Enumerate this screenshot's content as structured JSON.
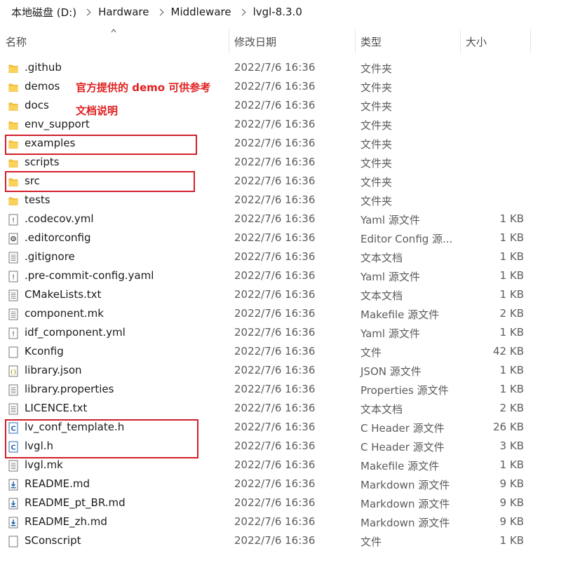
{
  "breadcrumb": [
    "本地磁盘 (D:)",
    "Hardware",
    "Middleware",
    "lvgl-8.3.0"
  ],
  "columns": {
    "name": "名称",
    "date": "修改日期",
    "type": "类型",
    "size": "大小"
  },
  "files": [
    {
      "name": ".github",
      "date": "2022/7/6 16:36",
      "type": "文件夹",
      "size": "",
      "icon": "folder-icon"
    },
    {
      "name": "demos",
      "date": "2022/7/6 16:36",
      "type": "文件夹",
      "size": "",
      "icon": "folder-icon"
    },
    {
      "name": "docs",
      "date": "2022/7/6 16:36",
      "type": "文件夹",
      "size": "",
      "icon": "folder-icon"
    },
    {
      "name": "env_support",
      "date": "2022/7/6 16:36",
      "type": "文件夹",
      "size": "",
      "icon": "folder-icon"
    },
    {
      "name": "examples",
      "date": "2022/7/6 16:36",
      "type": "文件夹",
      "size": "",
      "icon": "folder-icon"
    },
    {
      "name": "scripts",
      "date": "2022/7/6 16:36",
      "type": "文件夹",
      "size": "",
      "icon": "folder-icon"
    },
    {
      "name": "src",
      "date": "2022/7/6 16:36",
      "type": "文件夹",
      "size": "",
      "icon": "folder-icon"
    },
    {
      "name": "tests",
      "date": "2022/7/6 16:36",
      "type": "文件夹",
      "size": "",
      "icon": "folder-icon"
    },
    {
      "name": ".codecov.yml",
      "date": "2022/7/6 16:36",
      "type": "Yaml 源文件",
      "size": "1 KB",
      "icon": "yaml-file-icon"
    },
    {
      "name": ".editorconfig",
      "date": "2022/7/6 16:36",
      "type": "Editor Config 源...",
      "size": "1 KB",
      "icon": "config-file-icon"
    },
    {
      "name": ".gitignore",
      "date": "2022/7/6 16:36",
      "type": "文本文档",
      "size": "1 KB",
      "icon": "text-file-icon"
    },
    {
      "name": ".pre-commit-config.yaml",
      "date": "2022/7/6 16:36",
      "type": "Yaml 源文件",
      "size": "1 KB",
      "icon": "yaml-file-icon"
    },
    {
      "name": "CMakeLists.txt",
      "date": "2022/7/6 16:36",
      "type": "文本文档",
      "size": "1 KB",
      "icon": "text-file-icon"
    },
    {
      "name": "component.mk",
      "date": "2022/7/6 16:36",
      "type": "Makefile 源文件",
      "size": "2 KB",
      "icon": "text-file-icon"
    },
    {
      "name": "idf_component.yml",
      "date": "2022/7/6 16:36",
      "type": "Yaml 源文件",
      "size": "1 KB",
      "icon": "yaml-file-icon"
    },
    {
      "name": "Kconfig",
      "date": "2022/7/6 16:36",
      "type": "文件",
      "size": "42 KB",
      "icon": "blank-file-icon"
    },
    {
      "name": "library.json",
      "date": "2022/7/6 16:36",
      "type": "JSON 源文件",
      "size": "1 KB",
      "icon": "json-file-icon"
    },
    {
      "name": "library.properties",
      "date": "2022/7/6 16:36",
      "type": "Properties 源文件",
      "size": "1 KB",
      "icon": "text-file-icon"
    },
    {
      "name": "LICENCE.txt",
      "date": "2022/7/6 16:36",
      "type": "文本文档",
      "size": "2 KB",
      "icon": "text-file-icon"
    },
    {
      "name": "lv_conf_template.h",
      "date": "2022/7/6 16:36",
      "type": "C Header 源文件",
      "size": "26 KB",
      "icon": "c-header-file-icon"
    },
    {
      "name": "lvgl.h",
      "date": "2022/7/6 16:36",
      "type": "C Header 源文件",
      "size": "3 KB",
      "icon": "c-header-file-icon"
    },
    {
      "name": "lvgl.mk",
      "date": "2022/7/6 16:36",
      "type": "Makefile 源文件",
      "size": "1 KB",
      "icon": "text-file-icon"
    },
    {
      "name": "README.md",
      "date": "2022/7/6 16:36",
      "type": "Markdown 源文件",
      "size": "9 KB",
      "icon": "markdown-file-icon"
    },
    {
      "name": "README_pt_BR.md",
      "date": "2022/7/6 16:36",
      "type": "Markdown 源文件",
      "size": "9 KB",
      "icon": "markdown-file-icon"
    },
    {
      "name": "README_zh.md",
      "date": "2022/7/6 16:36",
      "type": "Markdown 源文件",
      "size": "9 KB",
      "icon": "markdown-file-icon"
    },
    {
      "name": "SConscript",
      "date": "2022/7/6 16:36",
      "type": "文件",
      "size": "1 KB",
      "icon": "blank-file-icon"
    }
  ],
  "annotations": {
    "demos_note": "官方提供的 demo 可供参考",
    "docs_note": "文档说明"
  },
  "colors": {
    "annotation": "#e02020",
    "folder": "#f8c63d",
    "highlight_box": "#d21f2b"
  }
}
